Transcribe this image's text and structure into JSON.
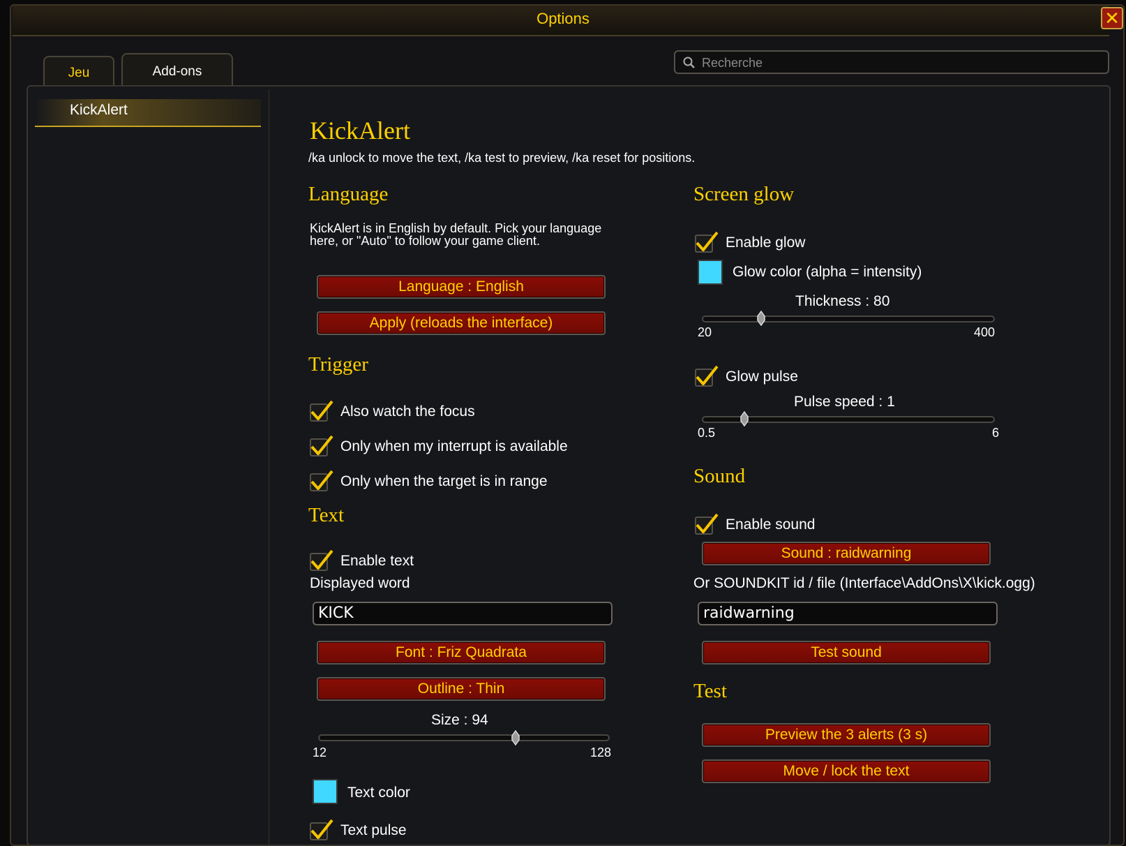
{
  "window": {
    "title": "Options",
    "close_icon": "close-icon"
  },
  "tabs": [
    {
      "label": "Jeu"
    },
    {
      "label": "Add-ons"
    }
  ],
  "search": {
    "placeholder": "Recherche"
  },
  "sidebar": {
    "items": [
      {
        "label": "KickAlert"
      }
    ]
  },
  "content": {
    "title": "KickAlert",
    "hint": "/ka unlock to move the text, /ka test to preview, /ka reset for positions.",
    "language": {
      "heading": "Language",
      "description": "KickAlert is in English by default. Pick your language here, or \"Auto\" to follow your game client.",
      "language_button": "Language : English",
      "apply_button": "Apply (reloads the interface)"
    },
    "trigger": {
      "heading": "Trigger",
      "options": [
        {
          "label": "Also watch the focus",
          "checked": true
        },
        {
          "label": "Only when my interrupt is available",
          "checked": true
        },
        {
          "label": "Only when the target is in range",
          "checked": true
        }
      ]
    },
    "text": {
      "heading": "Text",
      "enable_label": "Enable text",
      "enable_checked": true,
      "word_label": "Displayed word",
      "word_value": "KICK",
      "font_button": "Font : Friz Quadrata",
      "outline_button": "Outline : Thin",
      "size_label": "Size : 94",
      "size_value": 94,
      "size_min": "12",
      "size_max": "128",
      "color_label": "Text color",
      "color": "#40d8ff",
      "pulse_label": "Text pulse",
      "pulse_checked": true
    },
    "screen_glow": {
      "heading": "Screen glow",
      "enable_label": "Enable glow",
      "enable_checked": true,
      "color_label": "Glow color (alpha = intensity)",
      "color": "#40d8ff",
      "thickness_label": "Thickness : 80",
      "thickness_value": 80,
      "thickness_min": "20",
      "thickness_max": "400",
      "pulse_label": "Glow pulse",
      "pulse_checked": true,
      "speed_label": "Pulse speed : 1",
      "speed_value": 1,
      "speed_min": "0.5",
      "speed_max": "6"
    },
    "sound": {
      "heading": "Sound",
      "enable_label": "Enable sound",
      "enable_checked": true,
      "sound_button": "Sound : raidwarning",
      "soundkit_label": "Or SOUNDKIT id / file (Interface\\AddOns\\X\\kick.ogg)",
      "soundkit_value": "raidwarning",
      "test_button": "Test sound"
    },
    "test": {
      "heading": "Test",
      "preview_button": "Preview the 3 alerts (3 s)",
      "move_button": "Move / lock the text"
    }
  },
  "colors": {
    "gold": "#ffd100",
    "button_red": "#8a0d06",
    "swatch": "#40d8ff"
  }
}
